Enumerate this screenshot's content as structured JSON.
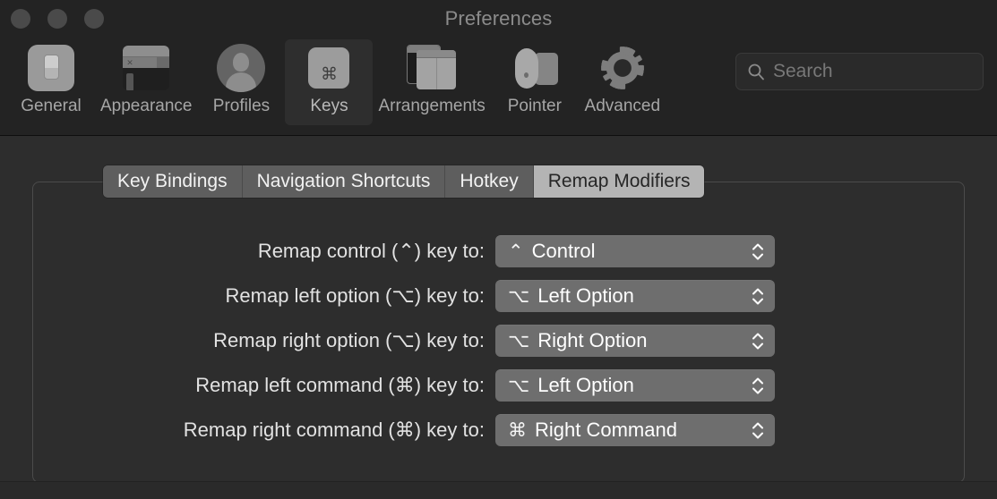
{
  "window": {
    "title": "Preferences",
    "traffic_lights": [
      "close",
      "minimize",
      "zoom"
    ]
  },
  "toolbar": {
    "items": [
      {
        "label": "General",
        "icon": "general-toggle-icon",
        "selected": false
      },
      {
        "label": "Appearance",
        "icon": "appearance-window-icon",
        "selected": false
      },
      {
        "label": "Profiles",
        "icon": "profiles-person-icon",
        "selected": false
      },
      {
        "label": "Keys",
        "icon": "keys-keycap-icon",
        "selected": true
      },
      {
        "label": "Arrangements",
        "icon": "arrangements-windows-icon",
        "selected": false
      },
      {
        "label": "Pointer",
        "icon": "pointer-mouse-icon",
        "selected": false
      },
      {
        "label": "Advanced",
        "icon": "advanced-gear-icon",
        "selected": false
      }
    ]
  },
  "search": {
    "placeholder": "Search",
    "value": "",
    "icon": "search-icon"
  },
  "tabs": [
    {
      "label": "Key Bindings",
      "selected": false
    },
    {
      "label": "Navigation Shortcuts",
      "selected": false
    },
    {
      "label": "Hotkey",
      "selected": false
    },
    {
      "label": "Remap Modifiers",
      "selected": true
    }
  ],
  "remap_rows": [
    {
      "label": "Remap control (⌃) key to:",
      "symbol": "⌃",
      "value": "Control"
    },
    {
      "label": "Remap left option (⌥) key to:",
      "symbol": "⌥",
      "value": "Left Option"
    },
    {
      "label": "Remap right option (⌥) key to:",
      "symbol": "⌥",
      "value": "Right Option"
    },
    {
      "label": "Remap left command (⌘) key to:",
      "symbol": "⌥",
      "value": "Left Option"
    },
    {
      "label": "Remap right command (⌘) key to:",
      "symbol": "⌘",
      "value": "Right Command"
    }
  ],
  "colors": {
    "toolbar_bg": "#232323",
    "content_bg": "#2d2d2d",
    "tab_bg": "#5e5e5e",
    "tab_selected_bg": "#b4b4b4",
    "popup_bg": "#6e6e6e",
    "label_text": "#e2e2e2",
    "title_text": "#8b8b8b"
  }
}
